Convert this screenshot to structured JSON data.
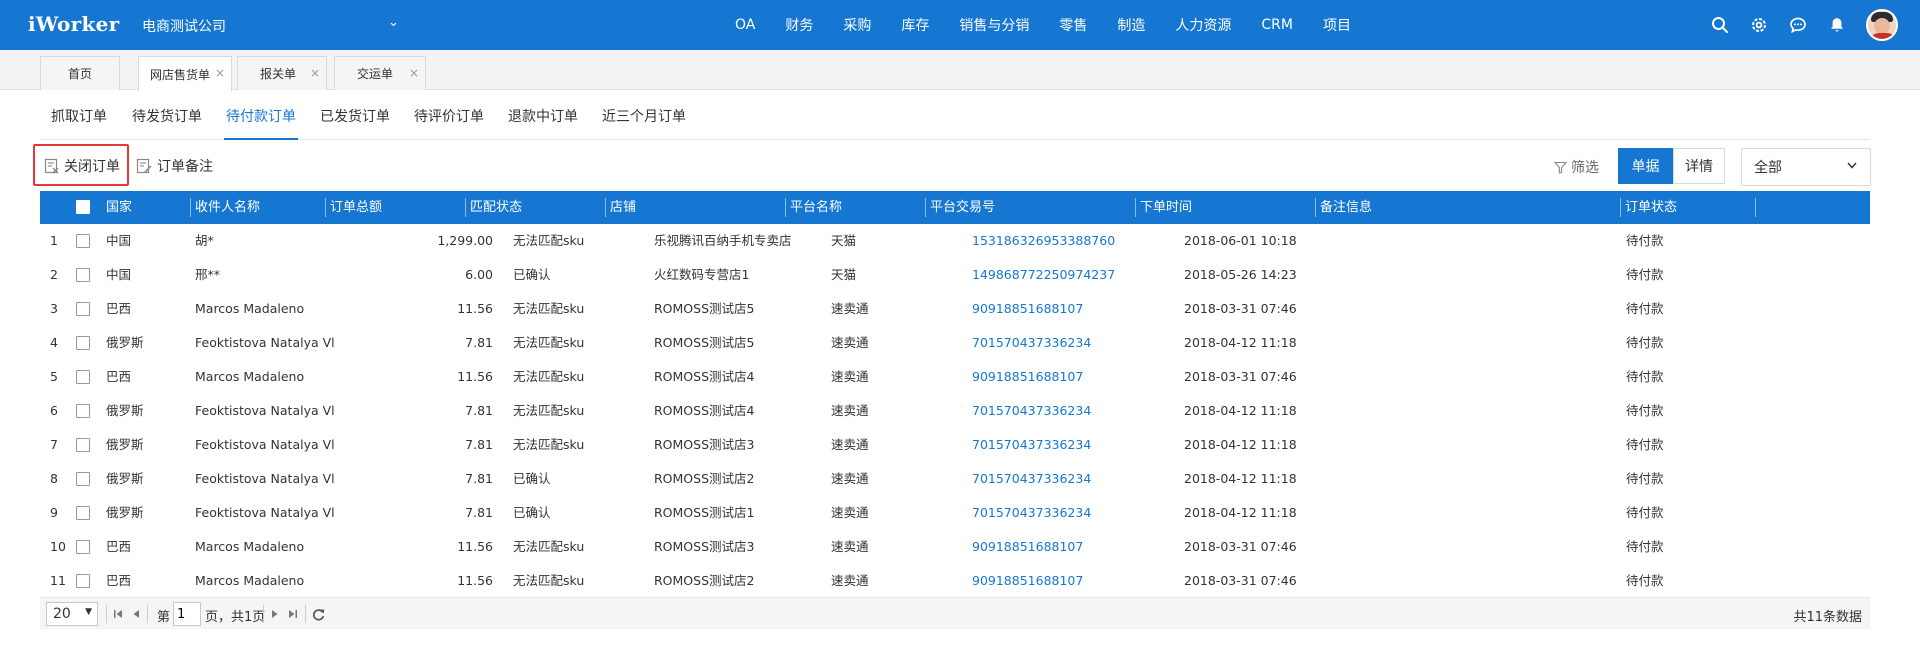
{
  "brand": {
    "logo": "iWorker",
    "company": "电商测试公司",
    "company_caret": "⌄"
  },
  "nav": [
    "OA",
    "财务",
    "采购",
    "库存",
    "销售与分销",
    "零售",
    "制造",
    "人力资源",
    "CRM",
    "项目"
  ],
  "header_icons": [
    "search-icon",
    "gear-icon",
    "chat-icon",
    "bell-icon"
  ],
  "page_tabs": [
    {
      "label": "首页",
      "closable": false
    },
    {
      "label": "网店售货单",
      "closable": true,
      "active": true
    },
    {
      "label": "报关单",
      "closable": true
    },
    {
      "label": "交运单",
      "closable": true
    }
  ],
  "close_glyph": "×",
  "sub_tabs": [
    "抓取订单",
    "待发货订单",
    "待付款订单",
    "已发货订单",
    "待评价订单",
    "退款中订单",
    "近三个月订单"
  ],
  "active_sub_tab": "待付款订单",
  "toolbar": {
    "close_order": "关闭订单",
    "order_note": "订单备注",
    "filter": "筛选",
    "view_single": "单据",
    "view_detail": "详情",
    "scope_select": "全部"
  },
  "table": {
    "columns": [
      "国家",
      "收件人名称",
      "订单总额",
      "匹配状态",
      "店铺",
      "平台名称",
      "平台交易号",
      "下单时间",
      "备注信息",
      "订单状态"
    ],
    "rows": [
      [
        "1",
        "中国",
        "胡*",
        "1,299.00",
        "无法匹配sku",
        "乐视腾讯百纳手机专卖店",
        "天猫",
        "153186326953388760",
        "2018-06-01 10:18",
        "",
        "待付款"
      ],
      [
        "2",
        "中国",
        "邢**",
        "6.00",
        "已确认",
        "火红数码专营店1",
        "天猫",
        "149868772250974237",
        "2018-05-26 14:23",
        "",
        "待付款"
      ],
      [
        "3",
        "巴西",
        "Marcos Madaleno",
        "11.56",
        "无法匹配sku",
        "ROMOSS测试店5",
        "速卖通",
        "90918851688107",
        "2018-03-31 07:46",
        "",
        "待付款"
      ],
      [
        "4",
        "俄罗斯",
        "Feoktistova Natalya Vladimirov",
        "7.81",
        "无法匹配sku",
        "ROMOSS测试店5",
        "速卖通",
        "701570437336234",
        "2018-04-12 11:18",
        "",
        "待付款"
      ],
      [
        "5",
        "巴西",
        "Marcos Madaleno",
        "11.56",
        "无法匹配sku",
        "ROMOSS测试店4",
        "速卖通",
        "90918851688107",
        "2018-03-31 07:46",
        "",
        "待付款"
      ],
      [
        "6",
        "俄罗斯",
        "Feoktistova Natalya Vladimirov",
        "7.81",
        "无法匹配sku",
        "ROMOSS测试店4",
        "速卖通",
        "701570437336234",
        "2018-04-12 11:18",
        "",
        "待付款"
      ],
      [
        "7",
        "俄罗斯",
        "Feoktistova Natalya Vladimirov",
        "7.81",
        "无法匹配sku",
        "ROMOSS测试店3",
        "速卖通",
        "701570437336234",
        "2018-04-12 11:18",
        "",
        "待付款"
      ],
      [
        "8",
        "俄罗斯",
        "Feoktistova Natalya Vladimirov",
        "7.81",
        "已确认",
        "ROMOSS测试店2",
        "速卖通",
        "701570437336234",
        "2018-04-12 11:18",
        "",
        "待付款"
      ],
      [
        "9",
        "俄罗斯",
        "Feoktistova Natalya Vladimirov",
        "7.81",
        "已确认",
        "ROMOSS测试店1",
        "速卖通",
        "701570437336234",
        "2018-04-12 11:18",
        "",
        "待付款"
      ],
      [
        "10",
        "巴西",
        "Marcos Madaleno",
        "11.56",
        "无法匹配sku",
        "ROMOSS测试店3",
        "速卖通",
        "90918851688107",
        "2018-03-31 07:46",
        "",
        "待付款"
      ],
      [
        "11",
        "巴西",
        "Marcos Madaleno",
        "11.56",
        "无法匹配sku",
        "ROMOSS测试店2",
        "速卖通",
        "90918851688107",
        "2018-03-31 07:46",
        "",
        "待付款"
      ]
    ]
  },
  "pager": {
    "page_size": "20",
    "page_prefix": "第",
    "current_page": "1",
    "page_suffix": "页，共1页",
    "total": "共11条数据"
  },
  "colors": {
    "primary": "#1677d2",
    "highlight_box": "#e53935",
    "link": "#1677d2"
  }
}
